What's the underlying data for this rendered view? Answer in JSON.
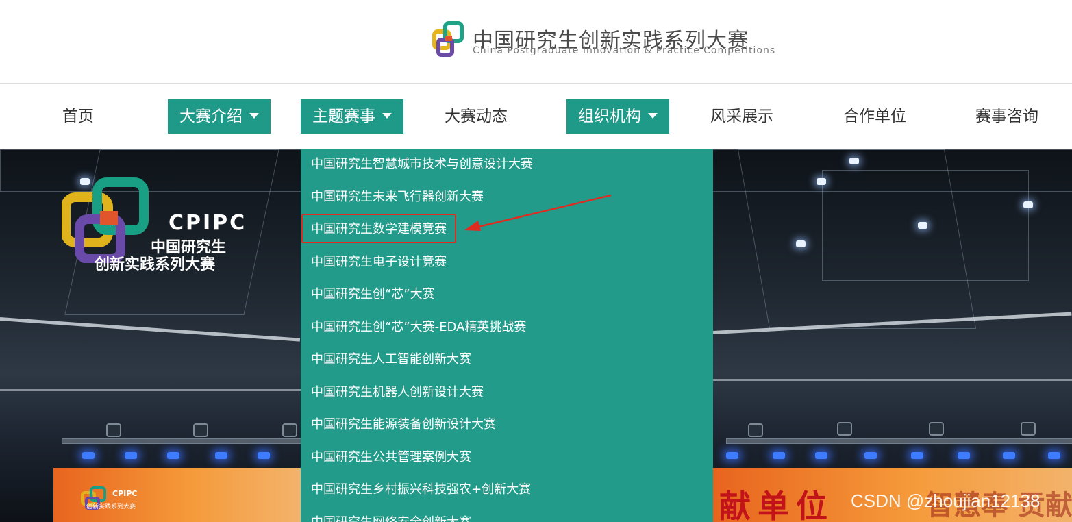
{
  "header": {
    "logo_icon": "cpipc-logo-icon",
    "title_cn": "中国研究生创新实践系列大赛",
    "title_en": "China Postgraduate Innovation & Practice Competitions"
  },
  "nav": {
    "items": [
      {
        "label": "首页",
        "active": false
      },
      {
        "label": "大赛介绍",
        "active": true,
        "has_dropdown": true
      },
      {
        "label": "主题赛事",
        "active": true,
        "has_dropdown": true
      },
      {
        "label": "大赛动态",
        "active": false
      },
      {
        "label": "组织机构",
        "active": true,
        "has_dropdown": true
      },
      {
        "label": "风采展示",
        "active": false
      },
      {
        "label": "合作单位",
        "active": false
      },
      {
        "label": "赛事咨询",
        "active": false
      }
    ],
    "caret_icon": "caret-down-icon",
    "active_color": "#1f9a89"
  },
  "dropdown": {
    "background": "#229b8a",
    "items": [
      "中国研究生智慧城市技术与创意设计大赛",
      "中国研究生未来飞行器创新大赛",
      "中国研究生数学建模竞赛",
      "中国研究生电子设计竞赛",
      "中国研究生创“芯”大赛",
      "中国研究生创“芯”大赛-EDA精英挑战赛",
      "中国研究生人工智能创新大赛",
      "中国研究生机器人创新设计大赛",
      "中国研究生能源装备创新设计大赛",
      "中国研究生公共管理案例大赛",
      "中国研究生乡村振兴科技强农+创新大赛",
      "中国研究生网络安全创新大赛"
    ],
    "highlighted_index": 2,
    "highlight_color": "#e02b20"
  },
  "hero": {
    "logo_en": "CPIPC",
    "logo_cn_line1": "中国研究生",
    "logo_cn_line2": "创新实践系列大赛",
    "small_logo_en": "CPIPC",
    "small_logo_cn": "创新实践系列大赛",
    "banner_text": "献单位",
    "banner_text_faded": "智慧奉 贡献",
    "watermark": "CSDN @zhoujian12138"
  }
}
